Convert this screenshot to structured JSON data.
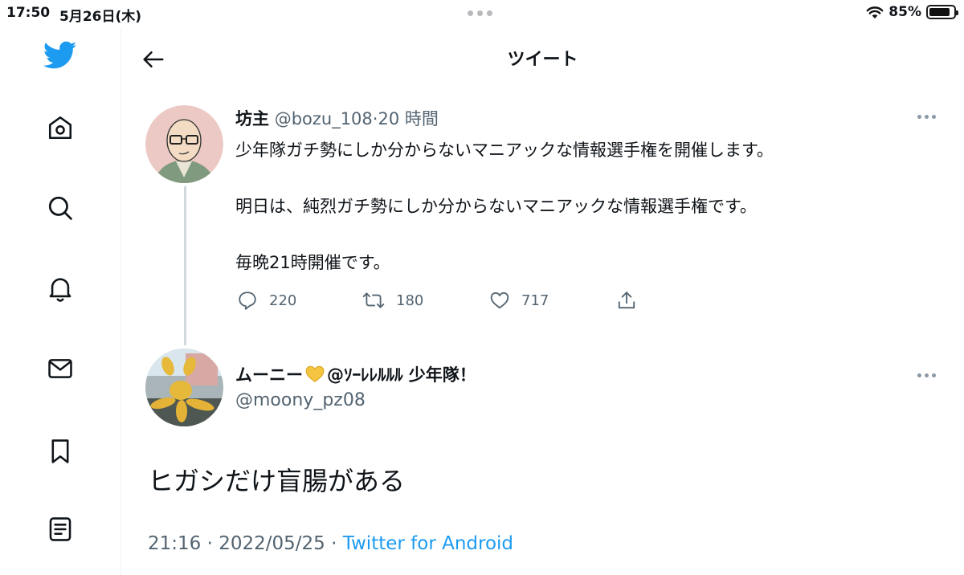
{
  "status_bar": {
    "time": "17:50",
    "date": "5月26日(木)",
    "battery": "85%",
    "battery_level": 0.85
  },
  "sidebar": {
    "items": [
      {
        "icon": "twitter-bird-icon"
      },
      {
        "icon": "home-icon"
      },
      {
        "icon": "search-icon"
      },
      {
        "icon": "bell-icon"
      },
      {
        "icon": "mail-icon"
      },
      {
        "icon": "bookmark-icon"
      },
      {
        "icon": "list-icon"
      }
    ]
  },
  "header": {
    "title": "ツイート"
  },
  "parent_tweet": {
    "name": "坊主",
    "handle": "@bozu_108",
    "separator": "·",
    "time": "20 時間",
    "lines": [
      "少年隊ガチ勢にしか分からないマニアックな情報選手権を開催します。",
      "明日は、純烈ガチ勢にしか分からないマニアックな情報選手権です。",
      "毎晩21時開催です。"
    ],
    "replies": "220",
    "retweets": "180",
    "likes": "717"
  },
  "main_tweet": {
    "name": "ムーニー",
    "name_suffix": "@ｿｰﾚﾚﾙﾙﾙ 少年隊！",
    "handle": "@moony_pz08",
    "text": "ヒガシだけ盲腸がある",
    "time": "21:16",
    "date": "2022/05/25",
    "sep1": "·",
    "sep2": "·",
    "source": "Twitter for Android"
  },
  "colors": {
    "accent": "#1d9bf0",
    "text": "#0f1419",
    "secondary": "#536471",
    "heart_emoji": "#f5c542"
  }
}
